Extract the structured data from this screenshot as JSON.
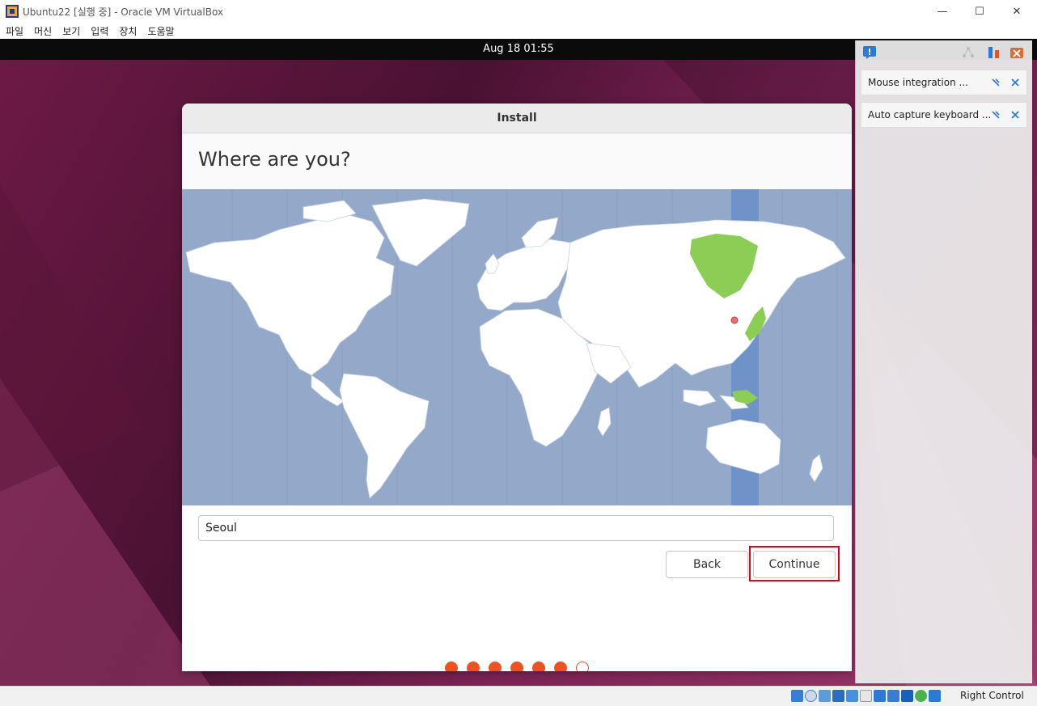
{
  "window": {
    "title": "Ubuntu22 [실행 중] - Oracle VM VirtualBox",
    "controls": {
      "minimize": "—",
      "maximize": "☐",
      "close": "✕"
    }
  },
  "menubar": {
    "items": [
      "파일",
      "머신",
      "보기",
      "입력",
      "장치",
      "도움말"
    ]
  },
  "ubuntu": {
    "clock": "Aug 18  01:55"
  },
  "installer": {
    "window_title": "Install",
    "heading": "Where are you?",
    "location_value": "Seoul",
    "back_label": "Back",
    "continue_label": "Continue",
    "progress": {
      "total_steps": 7,
      "completed_steps": 6
    }
  },
  "notifications": {
    "items": [
      {
        "label": "Mouse integration ..."
      },
      {
        "label": "Auto capture keyboard ..."
      }
    ]
  },
  "statusbar": {
    "host_key": "Right Control"
  },
  "colors": {
    "ubuntu_orange": "#e95420",
    "map_ocean": "#94a9c9",
    "map_land": "#ffffff",
    "timezone_band": "#6f92c8",
    "selected_timezone_land": "#8ccd55",
    "highlight_box": "#e2001a"
  },
  "icons": {
    "app": "virtualbox-icon",
    "notification_center": "notification-bell-icon",
    "pin": "pin-icon",
    "dismiss": "dismiss-icon"
  }
}
